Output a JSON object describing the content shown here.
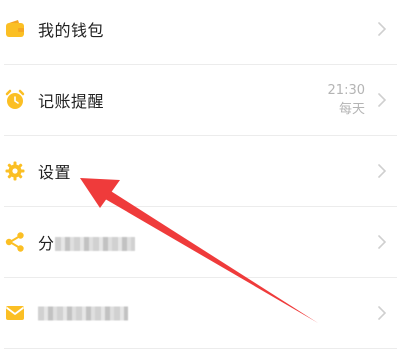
{
  "menu": {
    "wallet": {
      "label": "我的钱包",
      "icon": "wallet-icon"
    },
    "reminder": {
      "label": "记账提醒",
      "icon": "alarm-clock-icon",
      "time": "21:30",
      "frequency": "每天"
    },
    "settings": {
      "label": "设置",
      "icon": "gear-icon"
    },
    "share": {
      "label_visible": "分",
      "icon": "share-icon"
    },
    "mail": {
      "icon": "mail-icon"
    }
  },
  "colors": {
    "accent": "#fbbf24",
    "arrow": "#ef3b3b",
    "text": "#222222",
    "muted": "#b4b4b4"
  }
}
